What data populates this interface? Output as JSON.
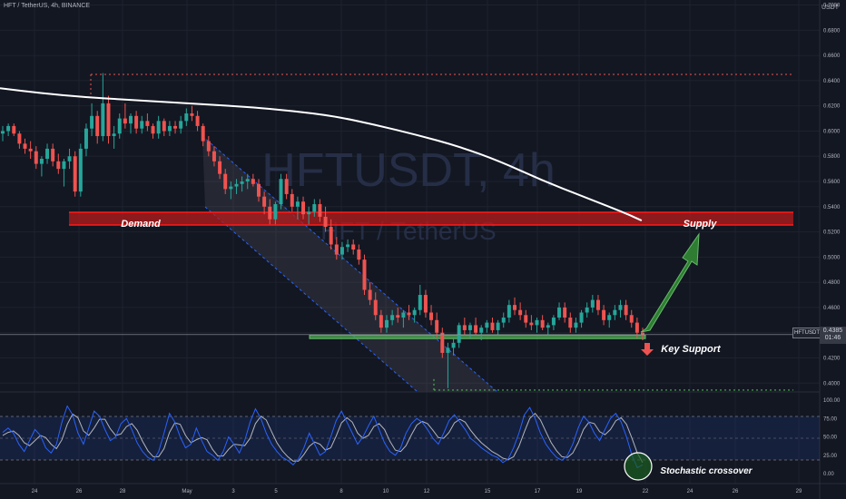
{
  "header": {
    "title": "HFT / TetherUS, 4h, BINANCE",
    "unit": "USDT"
  },
  "watermark": {
    "symbol": "HFTUSDT, 4h",
    "name": "HFT / TetherUS"
  },
  "annotations": {
    "demand": "Demand",
    "supply": "Supply",
    "key_support": "Key Support",
    "stoch": "Stochastic crossover"
  },
  "price_tag": {
    "ticker": "HFTUSDT",
    "price": "0.4385",
    "countdown": "01:46"
  },
  "colors": {
    "background": "#131722",
    "up": "#26a69a",
    "down": "#ef5350",
    "demand_zone": "#b71c1c",
    "support_zone": "#4caf50",
    "ma": "#ffffff",
    "stoch_k": "#2962ff",
    "stoch_d": "#b2b5be"
  },
  "chart_data": {
    "type": "candlestick",
    "y_ticks": [
      "0.7000",
      "0.6800",
      "0.6600",
      "0.6400",
      "0.6200",
      "0.6000",
      "0.5800",
      "0.5600",
      "0.5400",
      "0.5200",
      "0.5000",
      "0.4800",
      "0.4600",
      "0.4400",
      "0.4200",
      "0.4000"
    ],
    "x_ticks": [
      "24",
      "26",
      "28",
      "May",
      "3",
      "5",
      "8",
      "10",
      "12",
      "15",
      "17",
      "19",
      "22",
      "24",
      "26",
      "29"
    ],
    "osc_ticks": [
      "100.00",
      "75.00",
      "50.00",
      "25.00",
      "0.00"
    ],
    "ylim": [
      0.393,
      0.704
    ],
    "last_price": 0.4385,
    "levels": {
      "resistance_high": 0.645,
      "demand_top": 0.5355,
      "demand_bottom": 0.5255,
      "support_top": 0.4382,
      "support_bottom": 0.4357,
      "low": 0.3945
    },
    "candles": [
      [
        0.598,
        0.604,
        0.592,
        0.6
      ],
      [
        0.6,
        0.606,
        0.596,
        0.604
      ],
      [
        0.604,
        0.606,
        0.596,
        0.598
      ],
      [
        0.598,
        0.6,
        0.586,
        0.59
      ],
      [
        0.59,
        0.594,
        0.582,
        0.586
      ],
      [
        0.586,
        0.592,
        0.578,
        0.584
      ],
      [
        0.584,
        0.588,
        0.57,
        0.574
      ],
      [
        0.574,
        0.58,
        0.564,
        0.578
      ],
      [
        0.578,
        0.59,
        0.574,
        0.586
      ],
      [
        0.586,
        0.59,
        0.572,
        0.576
      ],
      [
        0.576,
        0.582,
        0.566,
        0.57
      ],
      [
        0.57,
        0.578,
        0.556,
        0.576
      ],
      [
        0.576,
        0.586,
        0.57,
        0.58
      ],
      [
        0.58,
        0.584,
        0.548,
        0.552
      ],
      [
        0.552,
        0.59,
        0.548,
        0.586
      ],
      [
        0.586,
        0.606,
        0.58,
        0.602
      ],
      [
        0.602,
        0.622,
        0.596,
        0.612
      ],
      [
        0.612,
        0.616,
        0.59,
        0.596
      ],
      [
        0.596,
        0.646,
        0.592,
        0.622
      ],
      [
        0.622,
        0.628,
        0.59,
        0.596
      ],
      [
        0.596,
        0.604,
        0.586,
        0.598
      ],
      [
        0.598,
        0.614,
        0.594,
        0.61
      ],
      [
        0.61,
        0.622,
        0.602,
        0.606
      ],
      [
        0.606,
        0.614,
        0.598,
        0.612
      ],
      [
        0.612,
        0.616,
        0.598,
        0.602
      ],
      [
        0.602,
        0.612,
        0.598,
        0.608
      ],
      [
        0.608,
        0.614,
        0.6,
        0.604
      ],
      [
        0.604,
        0.606,
        0.594,
        0.598
      ],
      [
        0.598,
        0.612,
        0.594,
        0.608
      ],
      [
        0.608,
        0.61,
        0.596,
        0.6
      ],
      [
        0.6,
        0.608,
        0.596,
        0.604
      ],
      [
        0.604,
        0.608,
        0.598,
        0.602
      ],
      [
        0.602,
        0.612,
        0.598,
        0.608
      ],
      [
        0.608,
        0.618,
        0.604,
        0.614
      ],
      [
        0.614,
        0.62,
        0.608,
        0.612
      ],
      [
        0.612,
        0.616,
        0.6,
        0.604
      ],
      [
        0.604,
        0.606,
        0.588,
        0.592
      ],
      [
        0.592,
        0.596,
        0.58,
        0.584
      ],
      [
        0.584,
        0.588,
        0.572,
        0.576
      ],
      [
        0.576,
        0.58,
        0.562,
        0.566
      ],
      [
        0.566,
        0.57,
        0.55,
        0.554
      ],
      [
        0.554,
        0.56,
        0.546,
        0.556
      ],
      [
        0.556,
        0.562,
        0.55,
        0.558
      ],
      [
        0.558,
        0.564,
        0.552,
        0.56
      ],
      [
        0.56,
        0.566,
        0.554,
        0.562
      ],
      [
        0.562,
        0.566,
        0.556,
        0.558
      ],
      [
        0.558,
        0.562,
        0.544,
        0.548
      ],
      [
        0.548,
        0.552,
        0.534,
        0.54
      ],
      [
        0.54,
        0.546,
        0.526,
        0.53
      ],
      [
        0.53,
        0.544,
        0.526,
        0.542
      ],
      [
        0.542,
        0.566,
        0.538,
        0.562
      ],
      [
        0.562,
        0.566,
        0.546,
        0.55
      ],
      [
        0.55,
        0.554,
        0.536,
        0.54
      ],
      [
        0.54,
        0.548,
        0.53,
        0.544
      ],
      [
        0.544,
        0.548,
        0.53,
        0.534
      ],
      [
        0.534,
        0.54,
        0.526,
        0.536
      ],
      [
        0.536,
        0.546,
        0.532,
        0.542
      ],
      [
        0.542,
        0.546,
        0.528,
        0.532
      ],
      [
        0.532,
        0.54,
        0.52,
        0.524
      ],
      [
        0.524,
        0.53,
        0.506,
        0.51
      ],
      [
        0.51,
        0.516,
        0.498,
        0.502
      ],
      [
        0.502,
        0.512,
        0.498,
        0.508
      ],
      [
        0.508,
        0.514,
        0.504,
        0.51
      ],
      [
        0.51,
        0.514,
        0.502,
        0.506
      ],
      [
        0.506,
        0.51,
        0.494,
        0.498
      ],
      [
        0.498,
        0.502,
        0.47,
        0.474
      ],
      [
        0.474,
        0.48,
        0.462,
        0.466
      ],
      [
        0.466,
        0.472,
        0.45,
        0.454
      ],
      [
        0.454,
        0.458,
        0.44,
        0.444
      ],
      [
        0.444,
        0.454,
        0.44,
        0.45
      ],
      [
        0.45,
        0.458,
        0.446,
        0.454
      ],
      [
        0.454,
        0.46,
        0.448,
        0.452
      ],
      [
        0.452,
        0.458,
        0.444,
        0.456
      ],
      [
        0.456,
        0.462,
        0.45,
        0.454
      ],
      [
        0.454,
        0.46,
        0.448,
        0.458
      ],
      [
        0.458,
        0.478,
        0.454,
        0.47
      ],
      [
        0.47,
        0.474,
        0.452,
        0.456
      ],
      [
        0.456,
        0.462,
        0.446,
        0.45
      ],
      [
        0.45,
        0.456,
        0.436,
        0.44
      ],
      [
        0.44,
        0.444,
        0.42,
        0.424
      ],
      [
        0.424,
        0.432,
        0.396,
        0.428
      ],
      [
        0.428,
        0.436,
        0.422,
        0.432
      ],
      [
        0.432,
        0.448,
        0.428,
        0.446
      ],
      [
        0.446,
        0.452,
        0.438,
        0.442
      ],
      [
        0.442,
        0.448,
        0.436,
        0.446
      ],
      [
        0.446,
        0.452,
        0.438,
        0.44
      ],
      [
        0.44,
        0.446,
        0.434,
        0.444
      ],
      [
        0.444,
        0.45,
        0.44,
        0.448
      ],
      [
        0.448,
        0.452,
        0.44,
        0.442
      ],
      [
        0.442,
        0.45,
        0.438,
        0.448
      ],
      [
        0.448,
        0.456,
        0.444,
        0.452
      ],
      [
        0.452,
        0.466,
        0.448,
        0.462
      ],
      [
        0.462,
        0.468,
        0.454,
        0.458
      ],
      [
        0.458,
        0.464,
        0.45,
        0.454
      ],
      [
        0.454,
        0.458,
        0.444,
        0.448
      ],
      [
        0.448,
        0.454,
        0.442,
        0.446
      ],
      [
        0.446,
        0.452,
        0.44,
        0.45
      ],
      [
        0.45,
        0.454,
        0.442,
        0.444
      ],
      [
        0.444,
        0.448,
        0.438,
        0.446
      ],
      [
        0.446,
        0.454,
        0.442,
        0.452
      ],
      [
        0.452,
        0.464,
        0.45,
        0.46
      ],
      [
        0.46,
        0.464,
        0.448,
        0.452
      ],
      [
        0.452,
        0.456,
        0.44,
        0.444
      ],
      [
        0.444,
        0.452,
        0.44,
        0.448
      ],
      [
        0.448,
        0.458,
        0.444,
        0.456
      ],
      [
        0.456,
        0.464,
        0.452,
        0.46
      ],
      [
        0.46,
        0.47,
        0.456,
        0.466
      ],
      [
        0.466,
        0.47,
        0.454,
        0.458
      ],
      [
        0.458,
        0.462,
        0.446,
        0.45
      ],
      [
        0.45,
        0.456,
        0.444,
        0.454
      ],
      [
        0.454,
        0.462,
        0.45,
        0.458
      ],
      [
        0.458,
        0.466,
        0.452,
        0.462
      ],
      [
        0.462,
        0.466,
        0.45,
        0.454
      ],
      [
        0.454,
        0.458,
        0.444,
        0.448
      ],
      [
        0.448,
        0.452,
        0.436,
        0.44
      ],
      [
        0.44,
        0.444,
        0.434,
        0.438
      ]
    ],
    "moving_average": [
      [
        0.0,
        0.634
      ],
      [
        0.05,
        0.63
      ],
      [
        0.1,
        0.627
      ],
      [
        0.15,
        0.625
      ],
      [
        0.2,
        0.623
      ],
      [
        0.25,
        0.621
      ],
      [
        0.3,
        0.619
      ],
      [
        0.35,
        0.616
      ],
      [
        0.4,
        0.612
      ],
      [
        0.45,
        0.605
      ],
      [
        0.5,
        0.597
      ],
      [
        0.55,
        0.588
      ],
      [
        0.6,
        0.576
      ],
      [
        0.65,
        0.561
      ],
      [
        0.7,
        0.548
      ],
      [
        0.75,
        0.535
      ],
      [
        0.77,
        0.529
      ]
    ],
    "stochastic": {
      "k": [
        56,
        62,
        55,
        40,
        30,
        45,
        60,
        52,
        35,
        28,
        40,
        70,
        92,
        80,
        55,
        40,
        62,
        85,
        78,
        60,
        45,
        50,
        68,
        75,
        60,
        42,
        30,
        22,
        18,
        30,
        55,
        82,
        70,
        50,
        35,
        40,
        62,
        45,
        30,
        25,
        18,
        30,
        50,
        40,
        28,
        45,
        70,
        88,
        75,
        55,
        40,
        30,
        22,
        18,
        12,
        20,
        35,
        55,
        40,
        25,
        30,
        50,
        72,
        85,
        70,
        55,
        40,
        50,
        65,
        78,
        60,
        42,
        30,
        25,
        35,
        55,
        68,
        75,
        70,
        60,
        48,
        40,
        55,
        72,
        80,
        70,
        60,
        48,
        42,
        35,
        30,
        25,
        22,
        15,
        20,
        35,
        55,
        80,
        90,
        75,
        55,
        40,
        30,
        22,
        18,
        25,
        40,
        62,
        78,
        70,
        55,
        45,
        60,
        75,
        82,
        70,
        50,
        25,
        8,
        12
      ],
      "d": [
        52,
        56,
        58,
        52,
        42,
        38,
        45,
        52,
        49,
        40,
        34,
        46,
        67,
        81,
        76,
        58,
        52,
        62,
        74,
        74,
        61,
        52,
        54,
        64,
        68,
        59,
        44,
        31,
        23,
        23,
        34,
        56,
        69,
        67,
        52,
        42,
        46,
        49,
        46,
        33,
        24,
        24,
        33,
        40,
        39,
        38,
        48,
        68,
        78,
        73,
        57,
        42,
        31,
        23,
        17,
        17,
        26,
        37,
        43,
        40,
        32,
        35,
        51,
        69,
        76,
        70,
        55,
        48,
        52,
        64,
        68,
        60,
        44,
        32,
        30,
        38,
        53,
        66,
        71,
        68,
        59,
        49,
        48,
        56,
        69,
        74,
        70,
        59,
        50,
        42,
        36,
        30,
        26,
        21,
        19,
        23,
        37,
        57,
        75,
        82,
        73,
        57,
        42,
        31,
        23,
        22,
        28,
        42,
        60,
        70,
        68,
        57,
        53,
        60,
        72,
        76,
        67,
        48,
        28,
        15
      ]
    }
  }
}
